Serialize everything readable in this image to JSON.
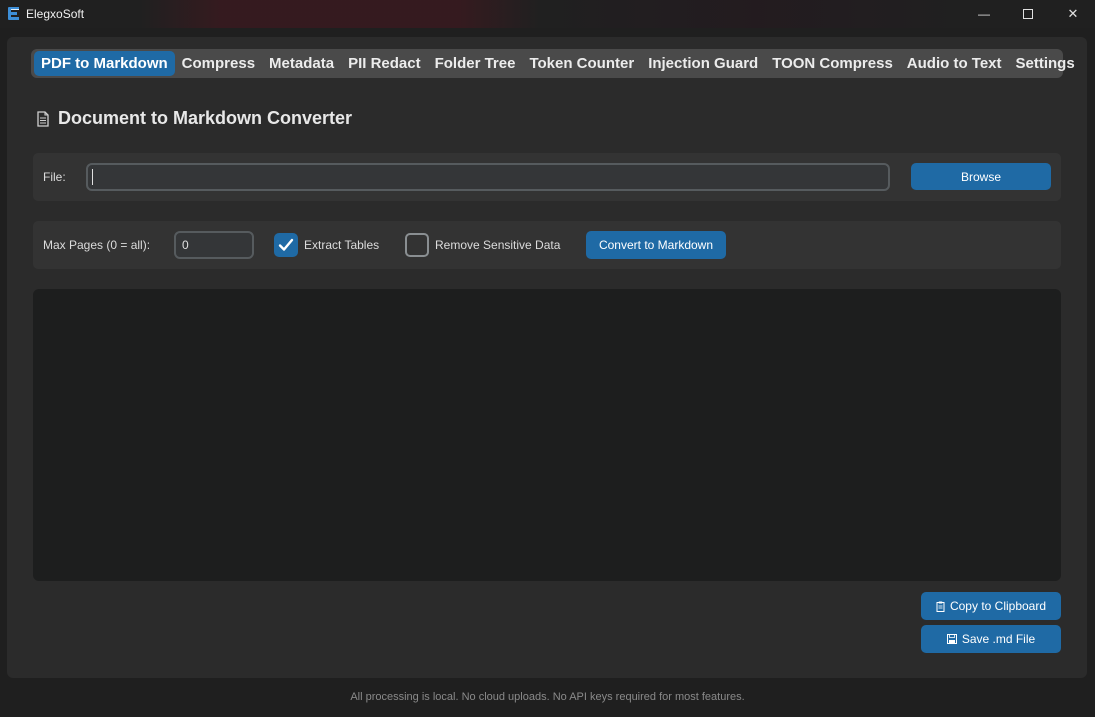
{
  "window": {
    "title": "ElegxoSoft",
    "minimize_glyph": "—",
    "maximize_glyph": "☐",
    "close_glyph": "✕"
  },
  "tabs": [
    {
      "label": "PDF to Markdown",
      "active": true
    },
    {
      "label": "Compress",
      "active": false
    },
    {
      "label": "Metadata",
      "active": false
    },
    {
      "label": "PII Redact",
      "active": false
    },
    {
      "label": "Folder Tree",
      "active": false
    },
    {
      "label": "Token Counter",
      "active": false
    },
    {
      "label": "Injection Guard",
      "active": false
    },
    {
      "label": "TOON Compress",
      "active": false
    },
    {
      "label": "Audio to Text",
      "active": false
    },
    {
      "label": "Settings",
      "active": false
    }
  ],
  "page": {
    "title": "Document to Markdown Converter",
    "title_icon": "document-icon"
  },
  "file_row": {
    "label": "File:",
    "value": "",
    "browse_label": "Browse"
  },
  "options": {
    "max_pages_label": "Max Pages (0 = all):",
    "max_pages_value": "0",
    "extract_tables_label": "Extract Tables",
    "extract_tables_checked": true,
    "remove_sensitive_label": "Remove Sensitive Data",
    "remove_sensitive_checked": false,
    "convert_label": "Convert to Markdown"
  },
  "actions": {
    "copy_label": "Copy to Clipboard",
    "save_label": "Save .md File"
  },
  "footer": {
    "text": "All processing is local. No cloud uploads. No API keys required for most features."
  },
  "colors": {
    "accent": "#1f6aa5",
    "background": "#1f1f1f",
    "panel": "#2b2b2b",
    "tabbar": "#4a4a4a"
  }
}
